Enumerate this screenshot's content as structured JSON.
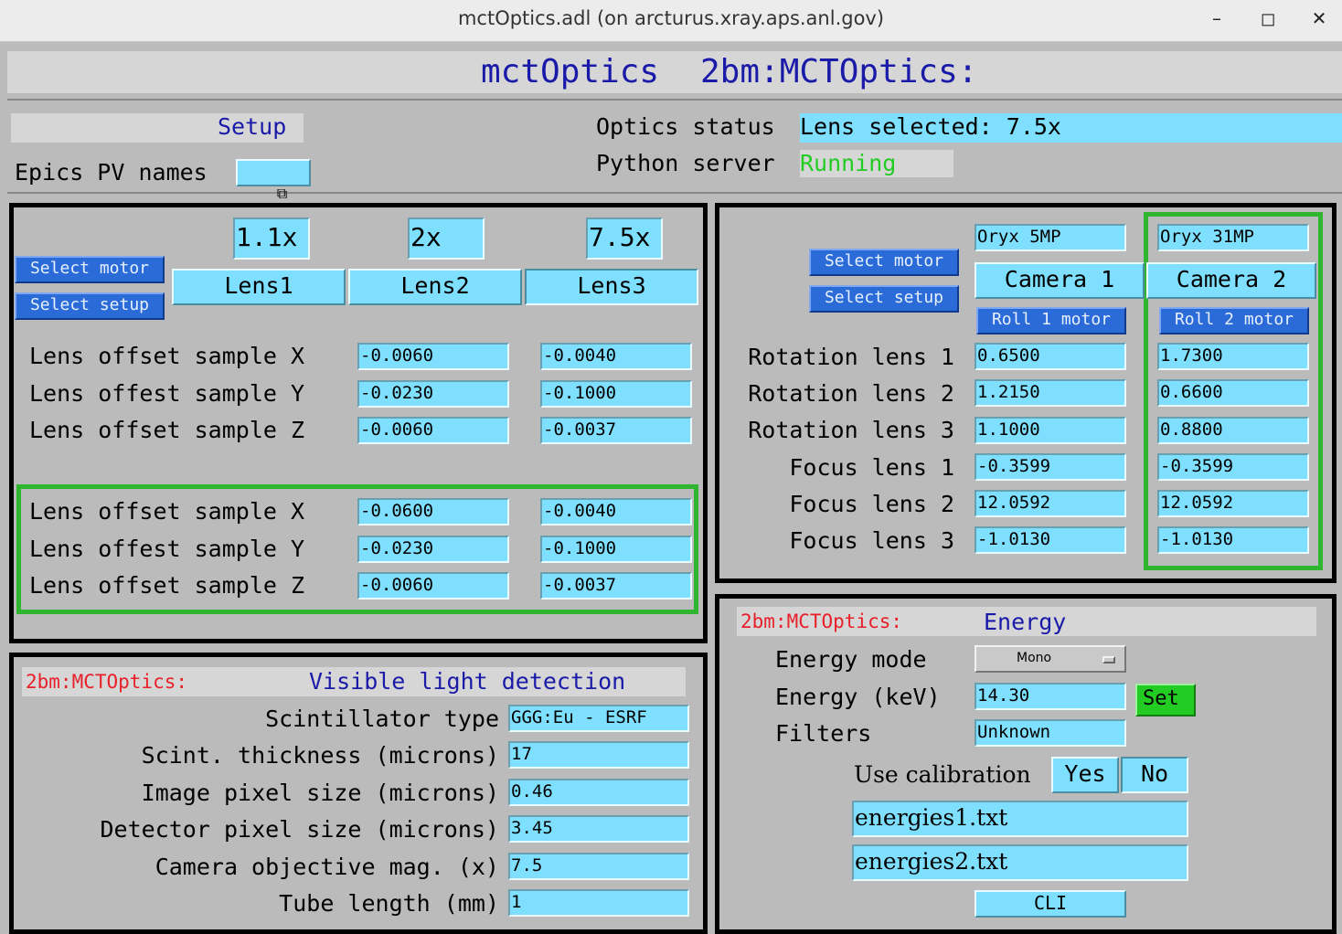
{
  "window": {
    "title": "mctOptics.adl (on arcturus.xray.aps.anl.gov)",
    "min_label": "–",
    "max_label": "◻",
    "close_label": "✕"
  },
  "banner": {
    "app": "mctOptics",
    "prefix": "2bm:MCTOptics:"
  },
  "header": {
    "setup_label": "Setup",
    "epics_label": "Epics PV names",
    "epics_button_icon": "related-display-icon",
    "optics_status_label": "Optics status",
    "optics_status_value": "Lens selected: 7.5x",
    "python_server_label": "Python server",
    "python_server_value": "Running"
  },
  "lens_panel": {
    "select_motor": "Select motor",
    "select_setup": "Select setup",
    "mags": [
      "1.1x",
      "2x",
      "7.5x"
    ],
    "lens_buttons": [
      "Lens1",
      "Lens2",
      "Lens3"
    ],
    "selected_lens": "Lens3",
    "rows_top": [
      {
        "label": "Lens offset sample X",
        "values": [
          "-0.0060",
          "-0.0040"
        ]
      },
      {
        "label": "Lens offest sample Y",
        "values": [
          "-0.0230",
          "-0.1000"
        ]
      },
      {
        "label": "Lens offset sample Z",
        "values": [
          "-0.0060",
          "-0.0037"
        ]
      }
    ],
    "rows_bottom": [
      {
        "label": "Lens offset sample X",
        "values": [
          "-0.0600",
          "-0.0040"
        ]
      },
      {
        "label": "Lens offest sample Y",
        "values": [
          "-0.0230",
          "-0.1000"
        ]
      },
      {
        "label": "Lens offset sample Z",
        "values": [
          "-0.0060",
          "-0.0037"
        ]
      }
    ]
  },
  "camera_panel": {
    "select_motor": "Select motor",
    "select_setup": "Select setup",
    "camera_names": [
      "Oryx 5MP",
      "Oryx 31MP"
    ],
    "camera_buttons": [
      "Camera 1",
      "Camera 2"
    ],
    "roll_buttons": [
      "Roll 1 motor",
      "Roll 2 motor"
    ],
    "rows": [
      {
        "label": "Rotation lens 1",
        "values": [
          "0.6500",
          "1.7300"
        ]
      },
      {
        "label": "Rotation lens 2",
        "values": [
          "1.2150",
          "0.6600"
        ]
      },
      {
        "label": "Rotation lens 3",
        "values": [
          "1.1000",
          "0.8800"
        ]
      },
      {
        "label": "Focus lens 1",
        "values": [
          "-0.3599",
          "-0.3599"
        ]
      },
      {
        "label": "Focus lens 2",
        "values": [
          "12.0592",
          "12.0592"
        ]
      },
      {
        "label": "Focus lens 3",
        "values": [
          "-1.0130",
          "-1.0130"
        ]
      }
    ]
  },
  "detection_panel": {
    "prefix": "2bm:MCTOptics:",
    "title": "Visible light detection",
    "rows": [
      {
        "label": "Scintillator type",
        "value": "GGG:Eu - ESRF"
      },
      {
        "label": "Scint. thickness (microns)",
        "value": "17"
      },
      {
        "label": "Image pixel size (microns)",
        "value": "0.46"
      },
      {
        "label": "Detector pixel size (microns)",
        "value": "3.45"
      },
      {
        "label": "Camera objective mag. (x)",
        "value": "7.5"
      },
      {
        "label": "Tube length (mm)",
        "value": "1"
      }
    ]
  },
  "energy_panel": {
    "prefix": "2bm:MCTOptics:",
    "title": "Energy",
    "mode_label": "Energy mode",
    "mode_value": "Mono",
    "energy_label": "Energy (keV)",
    "energy_value": "14.30",
    "set_label": "Set",
    "filters_label": "Filters",
    "filters_value": "Unknown",
    "calib_label": "Use calibration",
    "yes_label": "Yes",
    "no_label": "No",
    "file1": "energies1.txt",
    "file2": "energies2.txt",
    "cli_label": "CLI"
  },
  "colors": {
    "background": "#bbbbbb",
    "field": "#7fdfff",
    "blue_button": "#2a6bd8",
    "green_border": "#2fb52f",
    "status_green": "#22cc22",
    "set_green": "#22cc22",
    "banner_text": "#1a1aa8",
    "prefix_red": "#e8202a"
  }
}
